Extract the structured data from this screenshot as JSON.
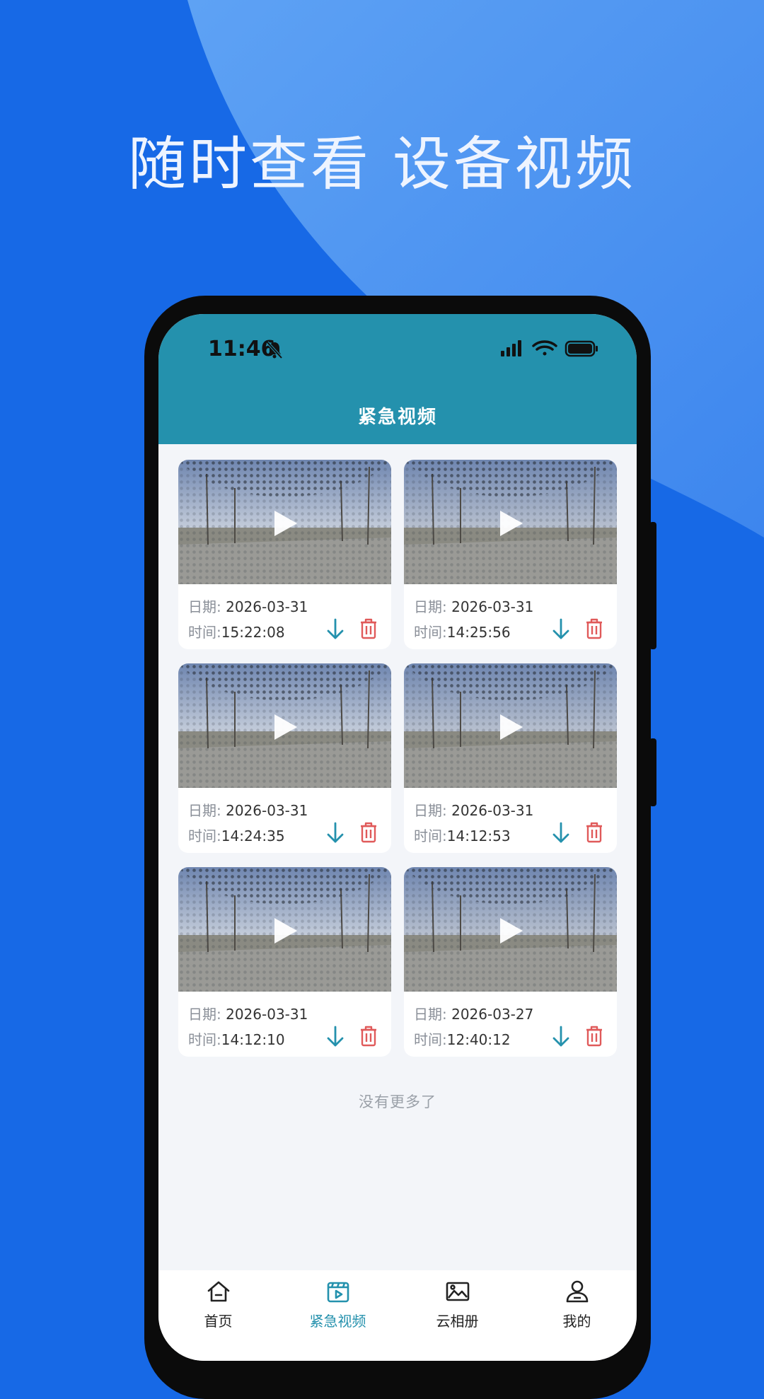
{
  "promo": {
    "headline": "随时查看 设备视频"
  },
  "status_bar": {
    "time": "11:46"
  },
  "header": {
    "title": "紧急视频"
  },
  "labels": {
    "date": "日期: ",
    "time": "时间:"
  },
  "videos": [
    {
      "date": "2026-03-31",
      "time": "15:22:08"
    },
    {
      "date": "2026-03-31",
      "time": "14:25:56"
    },
    {
      "date": "2026-03-31",
      "time": "14:24:35"
    },
    {
      "date": "2026-03-31",
      "time": "14:12:53"
    },
    {
      "date": "2026-03-31",
      "time": "14:12:10"
    },
    {
      "date": "2026-03-27",
      "time": "12:40:12"
    }
  ],
  "list_end_text": "没有更多了",
  "tabs": [
    {
      "label": "首页",
      "icon": "home-icon"
    },
    {
      "label": "紧急视频",
      "icon": "video-icon"
    },
    {
      "label": "云相册",
      "icon": "photo-icon"
    },
    {
      "label": "我的",
      "icon": "user-icon"
    }
  ],
  "colors": {
    "background": "#1769e6",
    "header": "#2491ad",
    "accent": "#2491ad",
    "delete": "#e05a5a"
  }
}
